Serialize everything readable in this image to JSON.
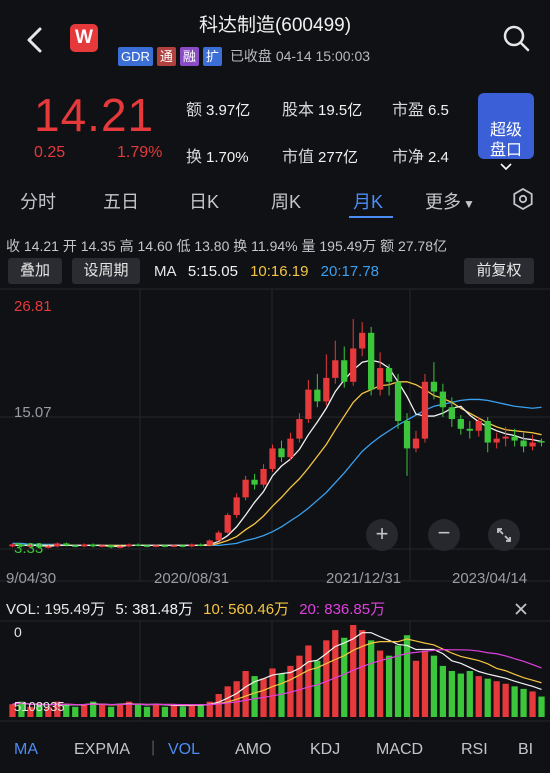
{
  "header": {
    "title": "科达制造(600499)",
    "logo": "W",
    "tags": [
      "GDR",
      "通",
      "融",
      "扩"
    ],
    "status": "已收盘 04-14 15:00:03"
  },
  "quote": {
    "price": "14.21",
    "change": "0.25",
    "change_pct": "1.79%",
    "stats": [
      {
        "label": "额",
        "value": "3.97亿"
      },
      {
        "label": "股本",
        "value": "19.5亿"
      },
      {
        "label": "市盈",
        "value": "6.5"
      },
      {
        "label": "换",
        "value": "1.70%"
      },
      {
        "label": "市值",
        "value": "277亿"
      },
      {
        "label": "市净",
        "value": "2.4"
      }
    ],
    "super_button": "超级\n盘口"
  },
  "tabs": [
    "分时",
    "五日",
    "日K",
    "周K",
    "月K",
    "更多"
  ],
  "active_tab": "月K",
  "info": {
    "text": "收 14.21  开 14.35  高 14.60  低 13.80  换 11.94%  量 195.49万  额 27.78亿"
  },
  "controls": {
    "overlay": "叠加",
    "period": "设周期",
    "ma_label": "MA",
    "ma5": "5:15.05",
    "ma10": "10:16.19",
    "ma20": "20:17.78",
    "adjust": "前复权"
  },
  "chart_data": {
    "type": "candlestick",
    "y_labels": {
      "top": "26.81",
      "mid": "15.07",
      "bottom": "3.33"
    },
    "x_labels": [
      "9/04/30",
      "2020/08/31",
      "2021/12/31",
      "2023/04/14"
    ],
    "ylim": [
      3.33,
      26.81
    ],
    "colors": {
      "up": "#e5393b",
      "down": "#3bc63b",
      "ma5": "#f2f2f2",
      "ma10": "#f5c542",
      "ma20": "#3aa0f0"
    },
    "candles": [
      [
        3.6,
        3.8,
        3.5,
        3.9
      ],
      [
        3.8,
        3.6,
        3.5,
        3.9
      ],
      [
        3.6,
        3.7,
        3.4,
        3.8
      ],
      [
        3.7,
        3.5,
        3.4,
        3.8
      ],
      [
        3.5,
        3.6,
        3.4,
        3.7
      ],
      [
        3.6,
        3.9,
        3.5,
        4.0
      ],
      [
        3.9,
        3.7,
        3.6,
        4.0
      ],
      [
        3.7,
        3.6,
        3.5,
        3.8
      ],
      [
        3.6,
        3.8,
        3.5,
        3.9
      ],
      [
        3.8,
        3.6,
        3.5,
        3.9
      ],
      [
        3.6,
        3.7,
        3.5,
        3.8
      ],
      [
        3.7,
        3.5,
        3.4,
        3.8
      ],
      [
        3.5,
        3.6,
        3.4,
        3.7
      ],
      [
        3.6,
        3.8,
        3.5,
        3.9
      ],
      [
        3.8,
        3.7,
        3.6,
        3.9
      ],
      [
        3.7,
        3.6,
        3.5,
        3.8
      ],
      [
        3.6,
        3.7,
        3.5,
        3.8
      ],
      [
        3.7,
        3.6,
        3.5,
        3.8
      ],
      [
        3.6,
        3.7,
        3.5,
        3.8
      ],
      [
        3.7,
        3.6,
        3.5,
        3.8
      ],
      [
        3.6,
        3.8,
        3.5,
        3.9
      ],
      [
        3.8,
        3.7,
        3.6,
        3.9
      ],
      [
        3.7,
        4.2,
        3.6,
        4.3
      ],
      [
        4.2,
        5.0,
        4.1,
        5.2
      ],
      [
        5.0,
        6.8,
        4.9,
        7.0
      ],
      [
        6.8,
        8.6,
        6.5,
        9.0
      ],
      [
        8.6,
        10.4,
        8.3,
        10.8
      ],
      [
        10.4,
        9.9,
        9.4,
        11.0
      ],
      [
        9.9,
        11.5,
        9.6,
        12.0
      ],
      [
        11.5,
        13.6,
        11.2,
        14.0
      ],
      [
        13.6,
        12.7,
        12.2,
        14.4
      ],
      [
        12.7,
        14.6,
        12.4,
        15.2
      ],
      [
        14.6,
        16.6,
        14.2,
        17.2
      ],
      [
        16.6,
        19.6,
        16.2,
        20.6
      ],
      [
        19.6,
        18.4,
        17.8,
        21.2
      ],
      [
        18.4,
        20.8,
        18.0,
        23.2
      ],
      [
        20.8,
        22.6,
        20.2,
        24.6
      ],
      [
        22.6,
        20.4,
        19.8,
        24.0
      ],
      [
        20.4,
        23.8,
        20.0,
        26.81
      ],
      [
        23.8,
        25.4,
        23.0,
        26.5
      ],
      [
        25.4,
        19.6,
        19.0,
        26.0
      ],
      [
        19.6,
        21.8,
        19.0,
        23.4
      ],
      [
        21.8,
        20.4,
        19.0,
        22.2
      ],
      [
        20.4,
        16.4,
        15.6,
        21.2
      ],
      [
        16.4,
        13.6,
        10.8,
        17.2
      ],
      [
        13.6,
        14.6,
        13.2,
        15.4
      ],
      [
        14.6,
        20.4,
        14.2,
        21.2
      ],
      [
        20.4,
        19.4,
        18.6,
        22.4
      ],
      [
        19.4,
        17.8,
        16.8,
        20.2
      ],
      [
        17.8,
        16.6,
        15.8,
        18.8
      ],
      [
        16.6,
        15.6,
        15.0,
        17.0
      ],
      [
        15.6,
        15.4,
        14.6,
        16.4
      ],
      [
        15.4,
        16.4,
        14.8,
        16.8
      ],
      [
        16.4,
        14.2,
        13.2,
        16.8
      ],
      [
        14.2,
        14.6,
        13.6,
        15.2
      ],
      [
        14.6,
        14.8,
        13.8,
        15.8
      ],
      [
        14.8,
        14.4,
        13.8,
        15.6
      ],
      [
        14.4,
        13.8,
        13.2,
        15.2
      ],
      [
        13.8,
        14.2,
        13.4,
        15.0
      ],
      [
        14.35,
        14.21,
        13.8,
        14.6
      ]
    ],
    "ma5": [
      3.7,
      3.7,
      3.7,
      3.7,
      3.6,
      3.7,
      3.7,
      3.7,
      3.7,
      3.7,
      3.7,
      3.6,
      3.6,
      3.7,
      3.7,
      3.7,
      3.7,
      3.7,
      3.7,
      3.7,
      3.7,
      3.7,
      3.8,
      4.1,
      4.7,
      5.6,
      6.8,
      8.1,
      9.2,
      10.8,
      11.8,
      12.5,
      13.5,
      15.0,
      16.3,
      17.7,
      19.4,
      20.6,
      21.6,
      22.4,
      22.6,
      22.4,
      21.8,
      20.4,
      18.9,
      17.1,
      16.9,
      16.9,
      17.2,
      17.7,
      17.9,
      17.0,
      16.3,
      15.8,
      15.4,
      15.1,
      14.9,
      14.6,
      14.5,
      14.3
    ],
    "ma10": [
      3.7,
      3.7,
      3.7,
      3.7,
      3.7,
      3.7,
      3.7,
      3.7,
      3.7,
      3.7,
      3.7,
      3.7,
      3.7,
      3.7,
      3.7,
      3.7,
      3.7,
      3.7,
      3.7,
      3.7,
      3.7,
      3.7,
      3.7,
      3.9,
      4.2,
      4.6,
      5.3,
      5.9,
      6.7,
      7.7,
      8.6,
      9.6,
      10.5,
      11.6,
      12.8,
      14.0,
      15.5,
      16.9,
      18.3,
      19.2,
      19.6,
      20.0,
      20.1,
      20.4,
      20.4,
      20.1,
      19.6,
      19.0,
      18.7,
      18.3,
      17.7,
      17.2,
      16.7,
      16.2,
      15.8,
      15.5,
      15.4,
      15.3,
      15.2,
      15.0
    ],
    "ma20": [
      3.9,
      3.9,
      3.8,
      3.8,
      3.8,
      3.8,
      3.7,
      3.7,
      3.7,
      3.7,
      3.7,
      3.7,
      3.7,
      3.7,
      3.7,
      3.7,
      3.7,
      3.7,
      3.7,
      3.7,
      3.7,
      3.7,
      3.7,
      3.7,
      3.8,
      3.9,
      4.2,
      4.4,
      4.7,
      5.1,
      5.6,
      6.2,
      6.8,
      7.5,
      8.3,
      9.1,
      10.1,
      11.1,
      12.2,
      13.3,
      14.1,
      14.8,
      15.4,
      16.0,
      16.5,
      17.0,
      17.5,
      17.9,
      18.1,
      18.3,
      18.5,
      18.6,
      18.6,
      18.5,
      18.3,
      18.1,
      17.9,
      17.8,
      17.7,
      17.8
    ],
    "volume": {
      "label": "VOL: 195.49万",
      "ma5": "5: 381.48万",
      "ma10": "10: 560.46万",
      "ma20": "20: 836.85万",
      "top_label": "0",
      "bottom_label": "5108935",
      "values": [
        5,
        6,
        4,
        5,
        4,
        6,
        5,
        4,
        5,
        6,
        5,
        4,
        5,
        6,
        5,
        4,
        5,
        4,
        5,
        4,
        5,
        5,
        6,
        9,
        12,
        14,
        18,
        16,
        15,
        19,
        17,
        20,
        24,
        28,
        22,
        30,
        34,
        31,
        36,
        34,
        30,
        26,
        24,
        28,
        32,
        22,
        26,
        24,
        20,
        18,
        17,
        18,
        16,
        15,
        14,
        13,
        12,
        11,
        10,
        8
      ],
      "up": [
        1,
        0,
        1,
        0,
        1,
        1,
        0,
        0,
        1,
        0,
        1,
        0,
        1,
        1,
        0,
        0,
        1,
        0,
        1,
        0,
        1,
        0,
        1,
        1,
        1,
        1,
        1,
        0,
        1,
        1,
        0,
        1,
        1,
        1,
        0,
        1,
        1,
        0,
        1,
        1,
        0,
        1,
        0,
        0,
        0,
        1,
        1,
        0,
        0,
        0,
        0,
        0,
        1,
        0,
        1,
        1,
        0,
        0,
        1,
        0
      ]
    }
  },
  "bottom_tabs": [
    "MA",
    "EXPMA",
    "VOL",
    "AMO",
    "KDJ",
    "MACD",
    "RSI",
    "BI"
  ]
}
